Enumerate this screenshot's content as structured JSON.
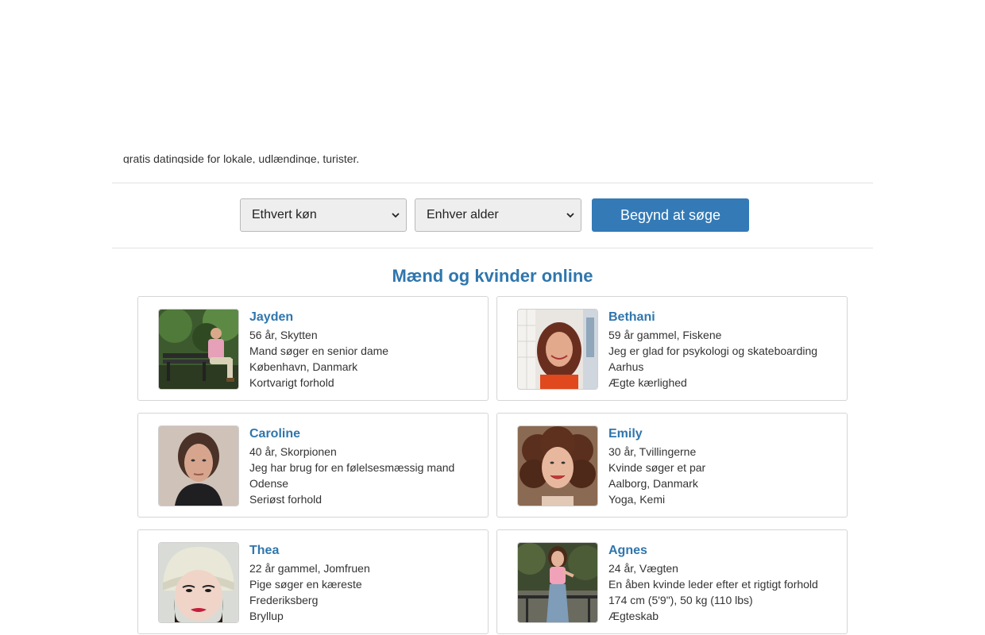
{
  "intro_text": "gratis datingside for lokale, udlændinge, turister.",
  "search": {
    "gender_select": "Ethvert køn",
    "age_select": "Enhver alder",
    "button_label": "Begynd at søge"
  },
  "section_title": "Mænd og kvinder online",
  "colors": {
    "accent": "#337ab7",
    "heading": "#2f76ad",
    "border": "#d5d5d5"
  },
  "profiles": [
    {
      "name": "Jayden",
      "lines": [
        "56 år, Skytten",
        "Mand søger en senior dame",
        "København, Danmark",
        "Kortvarigt forhold"
      ],
      "photo": "man-on-park-bench"
    },
    {
      "name": "Bethani",
      "lines": [
        "59 år gammel, Fiskene",
        "Jeg er glad for psykologi og skateboarding",
        "Aarhus",
        "Ægte kærlighed"
      ],
      "photo": "woman-red-hair-smiling"
    },
    {
      "name": "Caroline",
      "lines": [
        "40 år, Skorpionen",
        "Jeg har brug for en følelsesmæssig mand",
        "Odense",
        "Seriøst forhold"
      ],
      "photo": "woman-portrait-dark-scarf"
    },
    {
      "name": "Emily",
      "lines": [
        "30 år, Tvillingerne",
        "Kvinde søger et par",
        "Aalborg, Danmark",
        "Yoga, Kemi"
      ],
      "photo": "woman-curly-hair-smiling"
    },
    {
      "name": "Thea",
      "lines": [
        "22 år gammel, Jomfruen",
        "Pige søger en kæreste",
        "Frederiksberg",
        "Bryllup"
      ],
      "photo": "woman-knit-hat-selfie"
    },
    {
      "name": "Agnes",
      "lines": [
        "24 år, Vægten",
        "En åben kvinde leder efter et rigtigt forhold",
        "174 cm (5'9\"), 50 kg (110 lbs)",
        "Ægteskab"
      ],
      "photo": "woman-standing-outdoors"
    }
  ]
}
